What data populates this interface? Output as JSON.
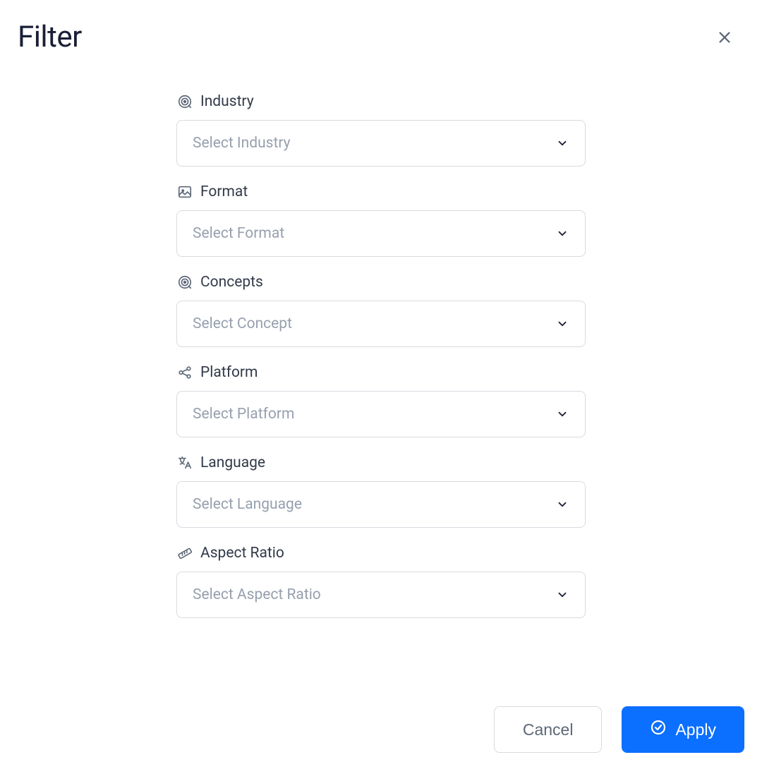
{
  "header": {
    "title": "Filter"
  },
  "fields": {
    "industry": {
      "label": "Industry",
      "placeholder": "Select Industry"
    },
    "format": {
      "label": "Format",
      "placeholder": "Select Format"
    },
    "concepts": {
      "label": "Concepts",
      "placeholder": "Select Concept"
    },
    "platform": {
      "label": "Platform",
      "placeholder": "Select Platform"
    },
    "language": {
      "label": "Language",
      "placeholder": "Select Language"
    },
    "aspect_ratio": {
      "label": "Aspect Ratio",
      "placeholder": "Select Aspect Ratio"
    }
  },
  "footer": {
    "cancel_label": "Cancel",
    "apply_label": "Apply"
  }
}
